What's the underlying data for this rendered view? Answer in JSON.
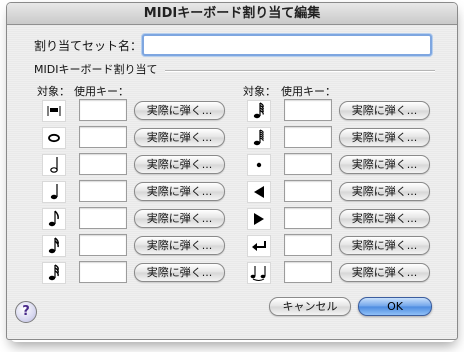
{
  "window": {
    "title": "MIDIキーボード割り当て編集"
  },
  "set_name": {
    "label": "割り当てセット名：",
    "value": ""
  },
  "group": {
    "title": "MIDIキーボード割り当て"
  },
  "columns": {
    "left": {
      "target_header": "対象：",
      "key_header": "使用キー："
    },
    "right": {
      "target_header": "対象：",
      "key_header": "使用キー："
    }
  },
  "left_rows": [
    {
      "icon": "whole-rest-icon",
      "key": "",
      "button": "実際に弾く..."
    },
    {
      "icon": "whole-note-icon",
      "key": "",
      "button": "実際に弾く..."
    },
    {
      "icon": "half-note-icon",
      "key": "",
      "button": "実際に弾く..."
    },
    {
      "icon": "quarter-note-icon",
      "key": "",
      "button": "実際に弾く..."
    },
    {
      "icon": "eighth-note-icon",
      "key": "",
      "button": "実際に弾く..."
    },
    {
      "icon": "sixteenth-note-icon",
      "key": "",
      "button": "実際に弾く..."
    },
    {
      "icon": "thirty-second-note-icon",
      "key": "",
      "button": "実際に弾く..."
    }
  ],
  "right_rows": [
    {
      "icon": "sixty-fourth-note-icon",
      "key": "",
      "button": "実際に弾く..."
    },
    {
      "icon": "hundred-twenty-eighth-note-icon",
      "key": "",
      "button": "実際に弾く..."
    },
    {
      "icon": "dot-icon",
      "key": "",
      "button": "実際に弾く..."
    },
    {
      "icon": "left-triangle-icon",
      "key": "",
      "button": "実際に弾く..."
    },
    {
      "icon": "right-triangle-icon",
      "key": "",
      "button": "実際に弾く..."
    },
    {
      "icon": "return-arrow-icon",
      "key": "",
      "button": "実際に弾く..."
    },
    {
      "icon": "tie-notes-icon",
      "key": "",
      "button": "実際に弾く..."
    }
  ],
  "buttons": {
    "cancel": "キャンセル",
    "ok": "OK",
    "help": "?"
  },
  "colors": {
    "focus_ring": "#7ea6e0",
    "ok_button": "#4c8be0"
  }
}
